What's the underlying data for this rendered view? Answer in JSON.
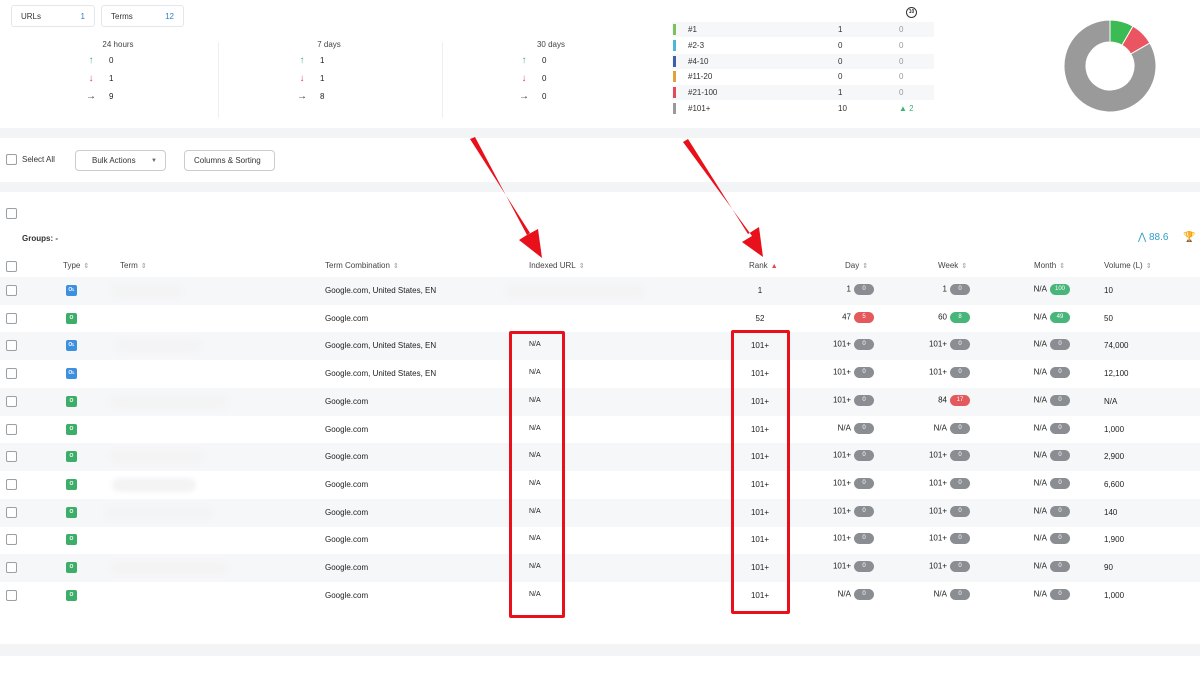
{
  "summary": {
    "urls_label": "URLs",
    "urls_count": "1",
    "terms_label": "Terms",
    "terms_count": "12"
  },
  "periods": [
    {
      "title": "24 hours",
      "up": "0",
      "down": "1",
      "same": "9"
    },
    {
      "title": "7 days",
      "up": "1",
      "down": "1",
      "same": "8"
    },
    {
      "title": "30 days",
      "up": "0",
      "down": "0",
      "same": "0"
    }
  ],
  "distribution": [
    {
      "label": "#1",
      "count": "1",
      "change": "0",
      "color": "#7ac35c"
    },
    {
      "label": "#2-3",
      "count": "0",
      "change": "0",
      "color": "#4cb7d6"
    },
    {
      "label": "#4-10",
      "count": "0",
      "change": "0",
      "color": "#3f5fad"
    },
    {
      "label": "#11-20",
      "count": "0",
      "change": "0",
      "color": "#e2a23b"
    },
    {
      "label": "#21-100",
      "count": "1",
      "change": "0",
      "color": "#e04a5a"
    },
    {
      "label": "#101+",
      "count": "10",
      "change": "▲ 2",
      "color": "#9a9a9a"
    }
  ],
  "donut": [
    {
      "name": "#1",
      "value": 1,
      "color": "#3cba54"
    },
    {
      "name": "#21-100",
      "value": 1,
      "color": "#ea5561"
    },
    {
      "name": "#101+",
      "value": 10,
      "color": "#9a9a9a"
    }
  ],
  "toolbar": {
    "select_all": "Select All",
    "bulk_actions": "Bulk Actions",
    "columns_sorting": "Columns & Sorting"
  },
  "groups_label": "Groups: -",
  "visibility_score": "88.6",
  "table": {
    "headers": {
      "type": "Type",
      "term": "Term",
      "combination": "Term Combination",
      "indexed_url": "Indexed URL",
      "rank": "Rank",
      "day": "Day",
      "week": "Week",
      "month": "Month",
      "volume": "Volume (L)"
    },
    "rows": [
      {
        "type": "Oʟ",
        "combination": "Google.com, United States, EN",
        "indexed": "",
        "rank": "1",
        "day": "1",
        "day_delta": "0",
        "week": "1",
        "week_delta": "0",
        "month": "N/A",
        "month_delta": "100",
        "volume": "10"
      },
      {
        "type": "O",
        "combination": "Google.com",
        "indexed": "",
        "rank": "52",
        "day": "47",
        "day_delta": "5",
        "week": "60",
        "week_delta": "8",
        "month": "N/A",
        "month_delta": "49",
        "volume": "50"
      },
      {
        "type": "Oʟ",
        "combination": "Google.com, United States, EN",
        "indexed": "N/A",
        "rank": "101+",
        "day": "101+",
        "day_delta": "0",
        "week": "101+",
        "week_delta": "0",
        "month": "N/A",
        "month_delta": "0",
        "volume": "74,000"
      },
      {
        "type": "Oʟ",
        "combination": "Google.com, United States, EN",
        "indexed": "N/A",
        "rank": "101+",
        "day": "101+",
        "day_delta": "0",
        "week": "101+",
        "week_delta": "0",
        "month": "N/A",
        "month_delta": "0",
        "volume": "12,100"
      },
      {
        "type": "O",
        "combination": "Google.com",
        "indexed": "N/A",
        "rank": "101+",
        "day": "101+",
        "day_delta": "0",
        "week": "84",
        "week_delta": "17",
        "month": "N/A",
        "month_delta": "0",
        "volume": "N/A"
      },
      {
        "type": "O",
        "combination": "Google.com",
        "indexed": "N/A",
        "rank": "101+",
        "day": "N/A",
        "day_delta": "0",
        "week": "N/A",
        "week_delta": "0",
        "month": "N/A",
        "month_delta": "0",
        "volume": "1,000"
      },
      {
        "type": "O",
        "combination": "Google.com",
        "indexed": "N/A",
        "rank": "101+",
        "day": "101+",
        "day_delta": "0",
        "week": "101+",
        "week_delta": "0",
        "month": "N/A",
        "month_delta": "0",
        "volume": "2,900"
      },
      {
        "type": "O",
        "combination": "Google.com",
        "indexed": "N/A",
        "rank": "101+",
        "day": "101+",
        "day_delta": "0",
        "week": "101+",
        "week_delta": "0",
        "month": "N/A",
        "month_delta": "0",
        "volume": "6,600"
      },
      {
        "type": "O",
        "combination": "Google.com",
        "indexed": "N/A",
        "rank": "101+",
        "day": "101+",
        "day_delta": "0",
        "week": "101+",
        "week_delta": "0",
        "month": "N/A",
        "month_delta": "0",
        "volume": "140"
      },
      {
        "type": "O",
        "combination": "Google.com",
        "indexed": "N/A",
        "rank": "101+",
        "day": "101+",
        "day_delta": "0",
        "week": "101+",
        "week_delta": "0",
        "month": "N/A",
        "month_delta": "0",
        "volume": "1,900"
      },
      {
        "type": "O",
        "combination": "Google.com",
        "indexed": "N/A",
        "rank": "101+",
        "day": "101+",
        "day_delta": "0",
        "week": "101+",
        "week_delta": "0",
        "month": "N/A",
        "month_delta": "0",
        "volume": "90"
      },
      {
        "type": "O",
        "combination": "Google.com",
        "indexed": "N/A",
        "rank": "101+",
        "day": "N/A",
        "day_delta": "0",
        "week": "N/A",
        "week_delta": "0",
        "month": "N/A",
        "month_delta": "0",
        "volume": "1,000"
      }
    ]
  },
  "colors": {
    "accent": "#2d7fc8",
    "annotation_red": "#e8101b",
    "positive": "#48b57a",
    "negative": "#e4595c",
    "neutral_pill": "#8a8d91",
    "local_badge": "#3d8fe0",
    "organic_badge": "#3dae6a"
  }
}
